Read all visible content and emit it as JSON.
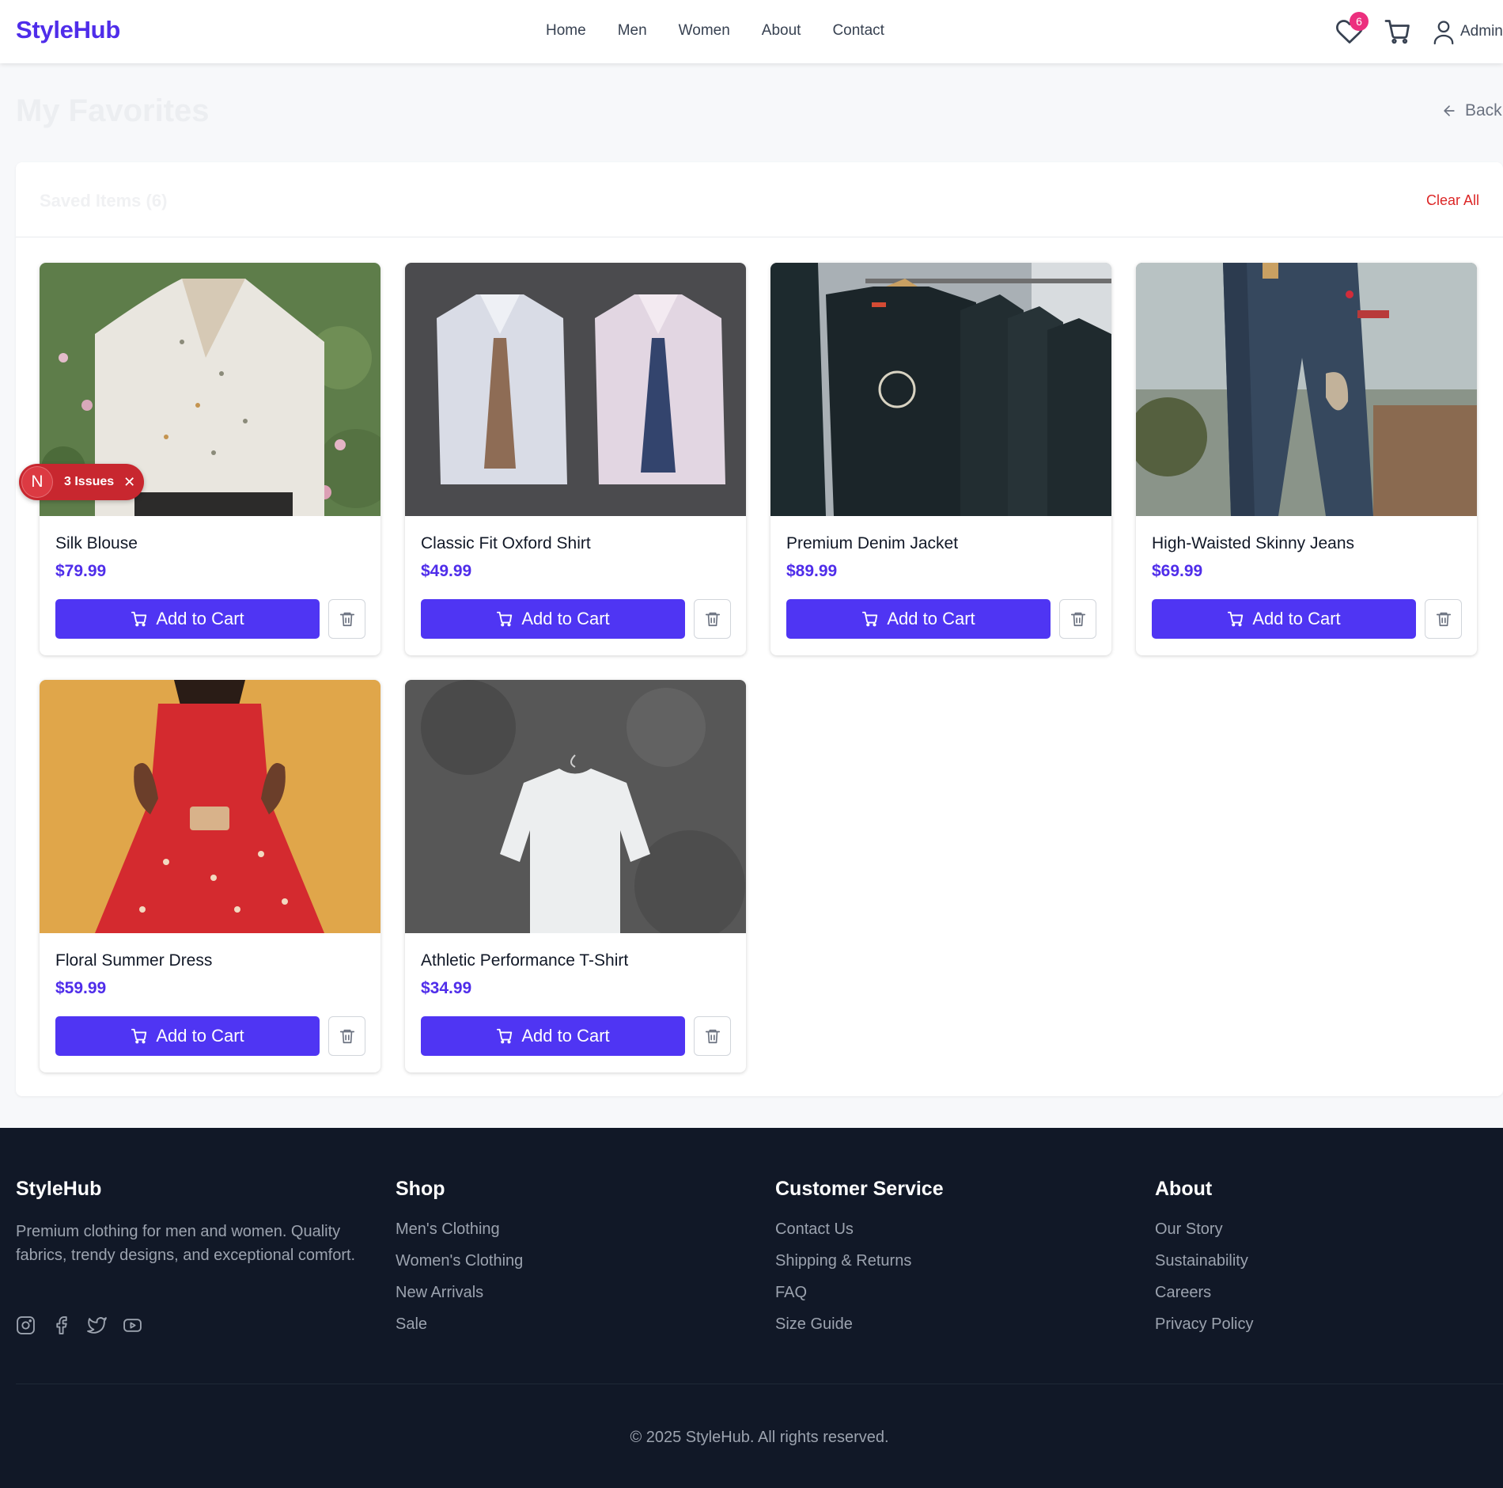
{
  "header": {
    "logo": "StyleHub",
    "nav": [
      "Home",
      "Men",
      "Women",
      "About",
      "Contact"
    ],
    "wishlist_count": "6",
    "user_label": "Admin"
  },
  "page": {
    "title": "My Favorites",
    "back_label": "Back"
  },
  "favorites": {
    "saved_title": "Saved Items (6)",
    "clear_all": "Clear All",
    "add_to_cart_label": "Add to Cart",
    "items": [
      {
        "name": "Silk Blouse",
        "price": "$79.99"
      },
      {
        "name": "Classic Fit Oxford Shirt",
        "price": "$49.99"
      },
      {
        "name": "Premium Denim Jacket",
        "price": "$89.99"
      },
      {
        "name": "High-Waisted Skinny Jeans",
        "price": "$69.99"
      },
      {
        "name": "Floral Summer Dress",
        "price": "$59.99"
      },
      {
        "name": "Athletic Performance T-Shirt",
        "price": "$34.99"
      }
    ]
  },
  "issues_badge": {
    "letter": "N",
    "label": "3 Issues"
  },
  "footer": {
    "brand": "StyleHub",
    "description": "Premium clothing for men and women. Quality fabrics, trendy designs, and exceptional comfort.",
    "columns": [
      {
        "title": "Shop",
        "links": [
          "Men's Clothing",
          "Women's Clothing",
          "New Arrivals",
          "Sale"
        ]
      },
      {
        "title": "Customer Service",
        "links": [
          "Contact Us",
          "Shipping & Returns",
          "FAQ",
          "Size Guide"
        ]
      },
      {
        "title": "About",
        "links": [
          "Our Story",
          "Sustainability",
          "Careers",
          "Privacy Policy"
        ]
      }
    ],
    "socials": [
      "instagram-icon",
      "facebook-icon",
      "twitter-icon",
      "youtube-icon"
    ],
    "copyright": "© 2025 StyleHub. All rights reserved."
  },
  "colors": {
    "brand": "#4f2dea",
    "button": "#4f35f3",
    "danger": "#dc2626",
    "badge": "#ec2f7e",
    "footer_bg": "#111827"
  }
}
